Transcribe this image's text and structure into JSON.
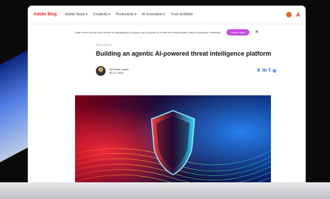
{
  "topbar": {
    "logo": "Adobe Blog",
    "nav": [
      "Adobe News ▾",
      "Creativity ▾",
      "Productivity ▾",
      "AI Innovation ▾",
      "Trust at Adobe"
    ]
  },
  "banner": {
    "text": "Learn more about how Adobe is integrating AI across our products in a safe and responsible way to empower creativity.",
    "button_label": "Learn more",
    "close_glyph": "✕"
  },
  "article": {
    "category": "SECURITY",
    "title": "Building an agentic AI-powered threat intelligence platform",
    "author_name": "Sai Kiran Lapali",
    "author_date": "06-17-2025"
  },
  "share": {
    "x": "X",
    "linkedin": "in",
    "facebook": "f",
    "copy": "⊘"
  },
  "colors": {
    "logo": "#e1251b",
    "banner_button": "#c64ee0",
    "share": "#1a56db"
  }
}
